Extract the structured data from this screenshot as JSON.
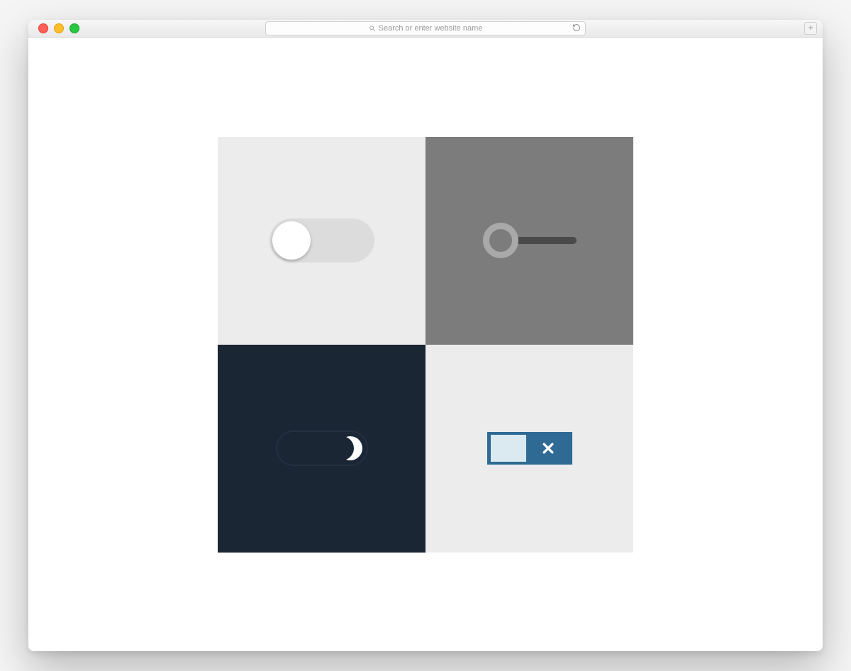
{
  "browser": {
    "address_placeholder": "Search or enter website name"
  },
  "icons": {
    "search": "search-icon",
    "reload": "reload-icon",
    "newtab": "plus-icon",
    "moon": "moon-icon",
    "close": "close-icon"
  },
  "toggles": {
    "t1": {
      "state": "off",
      "style": "classic-pill"
    },
    "t2": {
      "state": "off",
      "style": "ring-track"
    },
    "t3": {
      "state": "on",
      "style": "dark-moon"
    },
    "t4": {
      "state": "off",
      "style": "block-x"
    }
  },
  "colors": {
    "cell1": "#ececec",
    "cell2": "#7c7c7c",
    "cell3": "#1b2634",
    "cell4": "#ececec",
    "accent_blue": "#2f6a94"
  }
}
